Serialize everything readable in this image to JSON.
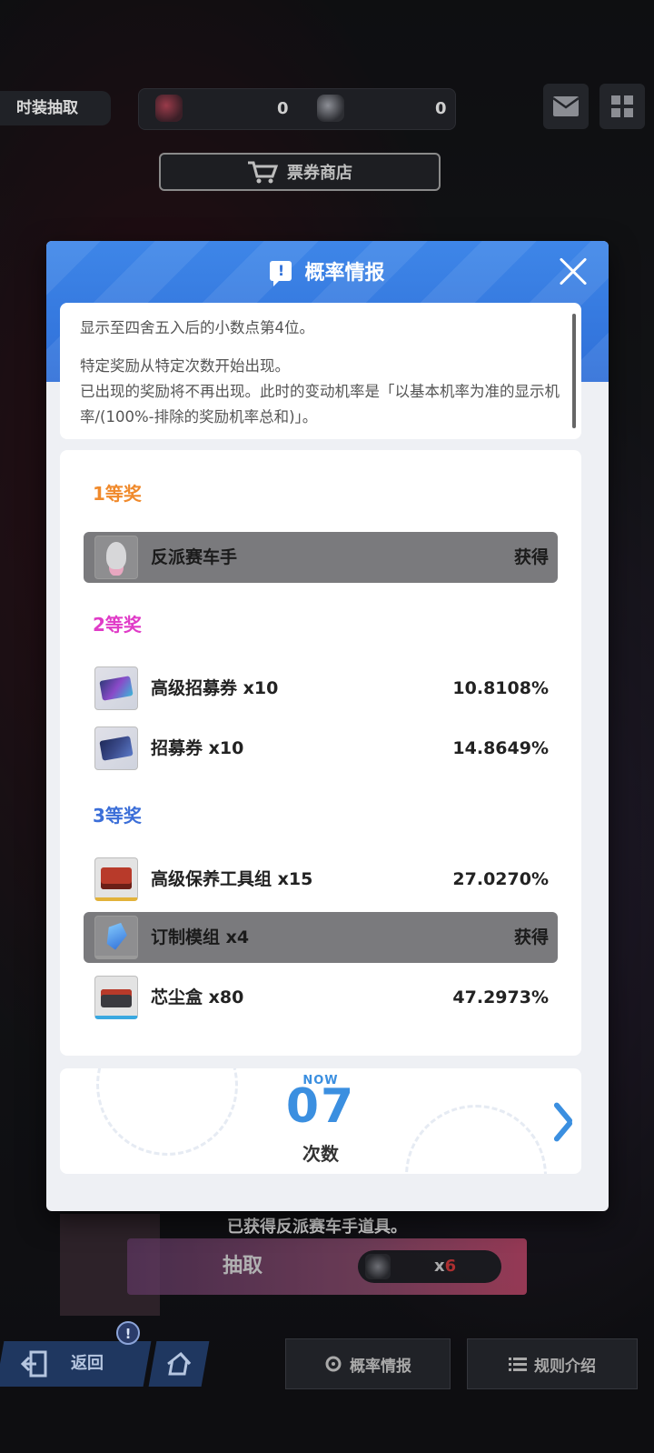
{
  "background": {
    "top_tab": "时装抽取",
    "currency": [
      {
        "icon": "red-token-icon",
        "value": "0"
      },
      {
        "icon": "grey-token-icon",
        "value": "0"
      }
    ],
    "shop_button": "票券商店",
    "obtained_text": "已获得反派赛车手道具。",
    "draw_button": "抽取",
    "draw_cost_prefix": "x",
    "draw_cost_value": "6",
    "back_button": "返回",
    "probability_button": "概率情报",
    "rules_button": "规则介绍"
  },
  "modal": {
    "title": "概率情报",
    "notice": {
      "line1": "显示至四舍五入后的小数点第4位。",
      "line2": "特定奖励从特定次数开始出现。",
      "line3": "已出现的奖励将不再出现。此时的变动机率是「以基本机率为准的显示机率/(100%-排除的奖励机率总和)」。"
    },
    "tiers": [
      {
        "label": "1等奖",
        "items": [
          {
            "name": "反派赛车手",
            "rate": "获得",
            "obtained": true
          }
        ]
      },
      {
        "label": "2等奖",
        "items": [
          {
            "name": "高级招募券 x10",
            "rate": "10.8108%",
            "obtained": false
          },
          {
            "name": "招募券 x10",
            "rate": "14.8649%",
            "obtained": false
          }
        ]
      },
      {
        "label": "3等奖",
        "items": [
          {
            "name": "高级保养工具组 x15",
            "rate": "27.0270%",
            "obtained": false
          },
          {
            "name": "订制模组 x4",
            "rate": "获得",
            "obtained": true
          },
          {
            "name": "芯尘盒 x80",
            "rate": "47.2973%",
            "obtained": false
          }
        ]
      }
    ],
    "counter": {
      "now_label": "NOW",
      "count": "07",
      "count_label": "次数"
    }
  }
}
